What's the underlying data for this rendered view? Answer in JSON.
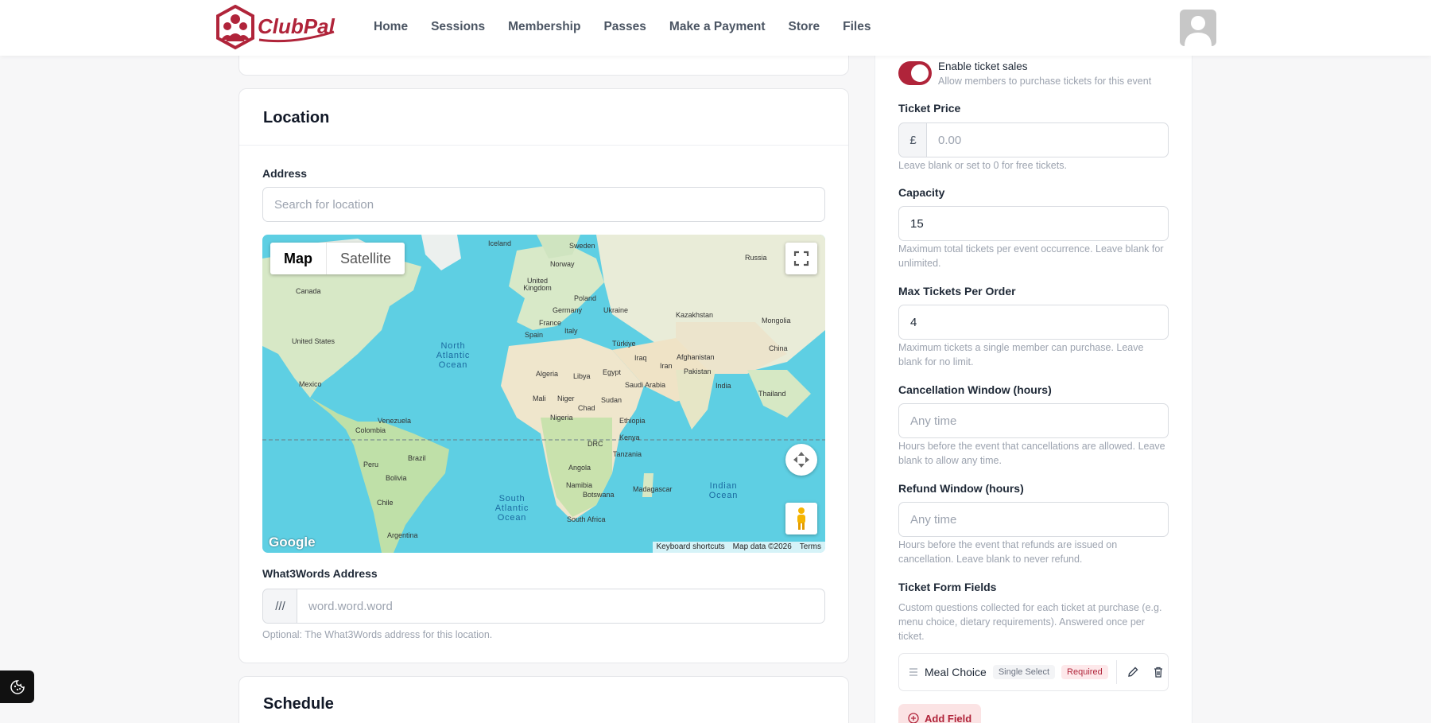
{
  "brand": {
    "name": "ClubPal",
    "color": "#b0243a"
  },
  "nav": {
    "items": [
      "Home",
      "Sessions",
      "Membership",
      "Passes",
      "Make a Payment",
      "Store",
      "Files"
    ]
  },
  "location": {
    "title": "Location",
    "address_label": "Address",
    "address_placeholder": "Search for location",
    "map": {
      "tab_map": "Map",
      "tab_satellite": "Satellite",
      "footer": {
        "shortcuts": "Keyboard shortcuts",
        "data": "Map data ©2026",
        "terms": "Terms"
      },
      "google": "Google",
      "places": [
        "Iceland",
        "Sweden",
        "Norway",
        "Russia",
        "Canada",
        "United Kingdom",
        "Poland",
        "Germany",
        "Ukraine",
        "Kazakhstan",
        "France",
        "Mongolia",
        "Italy",
        "Spain",
        "Türkiye",
        "United States",
        "Iraq",
        "Afghanistan",
        "China",
        "Iran",
        "Pakistan",
        "Algeria",
        "Libya",
        "Egypt",
        "Saudi Arabia",
        "India",
        "Mexico",
        "Thailand",
        "Mali",
        "Niger",
        "Chad",
        "Sudan",
        "Venezuela",
        "Nigeria",
        "Ethiopia",
        "Colombia",
        "Kenya",
        "DRC",
        "Tanzania",
        "Brazil",
        "Peru",
        "Angola",
        "Bolivia",
        "Namibia",
        "Madagascar",
        "Botswana",
        "Chile",
        "South Africa",
        "Argentina"
      ],
      "oceans": [
        "North Atlantic Ocean",
        "South Atlantic Ocean",
        "Indian Ocean"
      ]
    },
    "w3w_label": "What3Words Address",
    "w3w_prefix": "///",
    "w3w_placeholder": "word.word.word",
    "w3w_help": "Optional: The What3Words address for this location."
  },
  "schedule": {
    "title": "Schedule"
  },
  "tickets": {
    "enable_label": "Enable ticket sales",
    "enable_help": "Allow members to purchase tickets for this event",
    "enabled": true,
    "price_label": "Ticket Price",
    "currency": "£",
    "price_placeholder": "0.00",
    "price_help": "Leave blank or set to 0 for free tickets.",
    "capacity_label": "Capacity",
    "capacity_value": "15",
    "capacity_help": "Maximum total tickets per event occurrence. Leave blank for unlimited.",
    "max_label": "Max Tickets Per Order",
    "max_value": "4",
    "max_help": "Maximum tickets a single member can purchase. Leave blank for no limit.",
    "cancel_label": "Cancellation Window (hours)",
    "cancel_placeholder": "Any time",
    "cancel_help": "Hours before the event that cancellations are allowed. Leave blank to allow any time.",
    "refund_label": "Refund Window (hours)",
    "refund_placeholder": "Any time",
    "refund_help": "Hours before the event that refunds are issued on cancellation. Leave blank to never refund.",
    "form_label": "Ticket Form Fields",
    "form_help": "Custom questions collected for each ticket at purchase (e.g. menu choice, dietary requirements). Answered once per ticket.",
    "fields": [
      {
        "name": "Meal Choice",
        "type": "Single Select",
        "required": "Required"
      }
    ],
    "add_field": "Add Field"
  }
}
